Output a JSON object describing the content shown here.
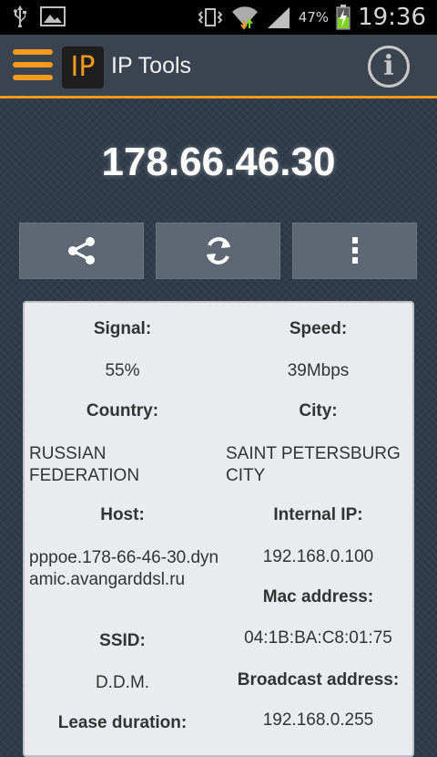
{
  "status_bar": {
    "battery_percent": "47%",
    "time": "19:36"
  },
  "app": {
    "title": "IP Tools",
    "logo_text": "IP"
  },
  "ip_address": "178.66.46.30",
  "toolbar": {
    "buttons": [
      "share-icon",
      "refresh-icon",
      "overflow-menu-icon"
    ]
  },
  "info": {
    "signal_label": "Signal:",
    "signal_value": "55%",
    "speed_label": "Speed:",
    "speed_value": "39Mbps",
    "country_label": "Country:",
    "country_value": "RUSSIAN FEDERATION",
    "city_label": "City:",
    "city_value": "SAINT PETERSBURG CITY",
    "host_label": "Host:",
    "host_value": "pppoe.178-66-46-30.dynamic.avangarddsl.ru",
    "internal_ip_label": "Internal IP:",
    "internal_ip_value": "192.168.0.100",
    "mac_label": "Mac address:",
    "mac_value": "04:1B:BA:C8:01:75",
    "ssid_label": "SSID:",
    "ssid_value": "D.D.M.",
    "broadcast_label": "Broadcast address:",
    "broadcast_value": "192.168.0.255",
    "lease_label": "Lease duration:"
  },
  "colors": {
    "accent": "#f49a1c",
    "background": "#2f3c4a",
    "card": "#e9ebee"
  }
}
